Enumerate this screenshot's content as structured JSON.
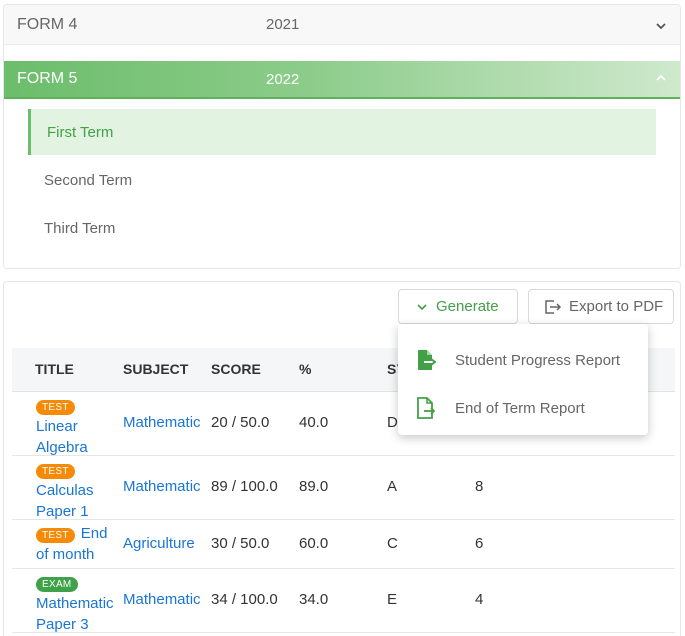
{
  "forms": [
    {
      "name": "FORM 4",
      "year": "2021",
      "expanded": false
    },
    {
      "name": "FORM 5",
      "year": "2022",
      "expanded": true
    }
  ],
  "terms": [
    {
      "label": "First Term",
      "active": true
    },
    {
      "label": "Second Term",
      "active": false
    },
    {
      "label": "Third Term",
      "active": false
    }
  ],
  "toolbar": {
    "generate_label": "Generate",
    "export_label": "Export to PDF"
  },
  "generate_menu": {
    "items": [
      "Student Progress Report",
      "End of Term Report"
    ]
  },
  "table": {
    "headers": [
      "TITLE",
      "SUBJECT",
      "SCORE",
      "%",
      "SY"
    ],
    "rows": [
      {
        "badge": "TEST",
        "title": "Linear Algebra",
        "subject": "Mathematic",
        "score": "20 / 50.0",
        "percent": "40.0",
        "grade": "D",
        "pos": ""
      },
      {
        "badge": "TEST",
        "title": "Calculas Paper 1",
        "subject": "Mathematic",
        "score": "89 / 100.0",
        "percent": "89.0",
        "grade": "A",
        "pos": "8"
      },
      {
        "badge": "TEST",
        "title": "End of month",
        "subject": "Agriculture",
        "score": "30 / 50.0",
        "percent": "60.0",
        "grade": "C",
        "pos": "6"
      },
      {
        "badge": "EXAM",
        "title": "Mathematic Paper 3",
        "subject": "Mathematic",
        "score": "34 / 100.0",
        "percent": "34.0",
        "grade": "E",
        "pos": "4"
      }
    ]
  },
  "colors": {
    "accent": "#43a047",
    "link": "#1976d2",
    "badge_test": "#f58a07",
    "badge_exam": "#3fa24a"
  }
}
